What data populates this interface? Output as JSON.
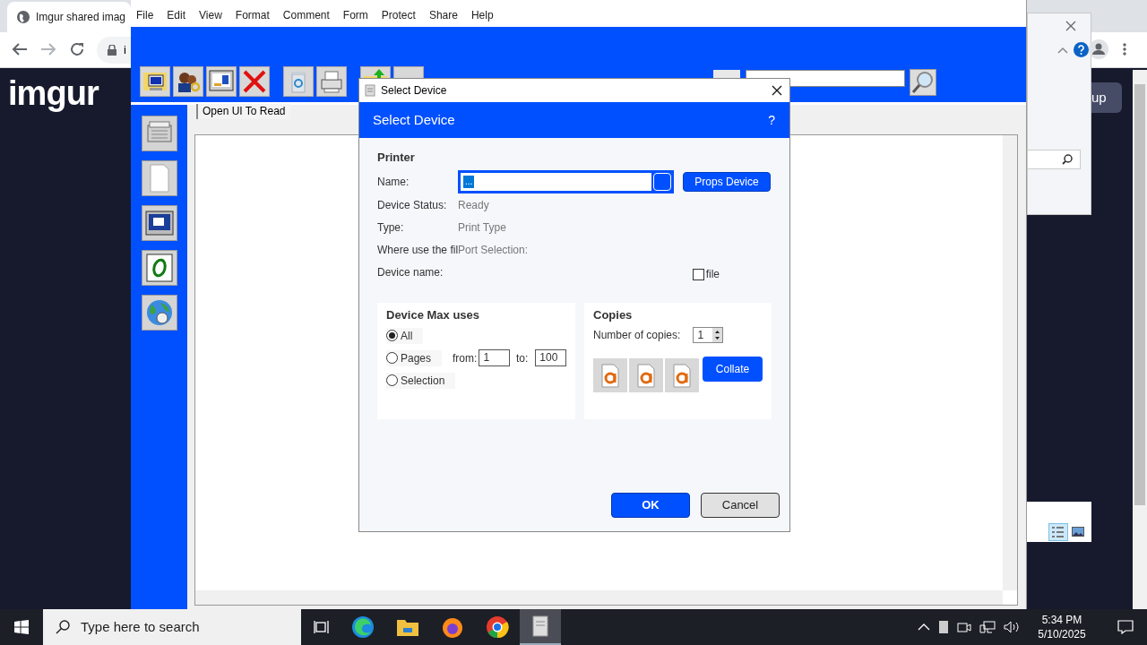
{
  "browser": {
    "tab_title": "Imgur shared imag",
    "address_partial": "i",
    "logo": "imgur",
    "signup_partial": "up"
  },
  "app": {
    "menu": [
      "File",
      "Edit",
      "View",
      "Format",
      "Comment",
      "Form",
      "Protect",
      "Share",
      "Help"
    ],
    "tab": "Open UI To Read"
  },
  "dialog": {
    "title": "Select Device",
    "header": "Select Device",
    "help": "?",
    "section": "Printer",
    "name_label": "Name:",
    "name_value": "...",
    "props_button": "Props Device",
    "rows": [
      {
        "label": "Device Status:",
        "value": "Ready"
      },
      {
        "label": "Type:",
        "value": "Print Type"
      },
      {
        "label": "Where use the fil",
        "value": "Port Selection:"
      },
      {
        "label": "Device name:"
      }
    ],
    "file_checkbox": {
      "label": "file",
      "checked": false
    },
    "range": {
      "title": "Device Max uses",
      "options": [
        {
          "kind": "plain",
          "label": "All",
          "selected": true
        },
        {
          "kind": "range",
          "label": "Pages",
          "selected": false,
          "from_label": "from:",
          "from_value": "1",
          "to_label": "to:",
          "to_value": "100"
        },
        {
          "kind": "plain",
          "label": "Selection",
          "selected": false
        }
      ]
    },
    "copies": {
      "title": "Copies",
      "label": "Number of copies:",
      "value": "1",
      "collate_button": "Collate"
    },
    "ok_button": "OK",
    "cancel_button": "Cancel"
  },
  "taskbar": {
    "search_placeholder": "Type here to search",
    "time": "5:34 PM",
    "date": "5/10/2025"
  }
}
